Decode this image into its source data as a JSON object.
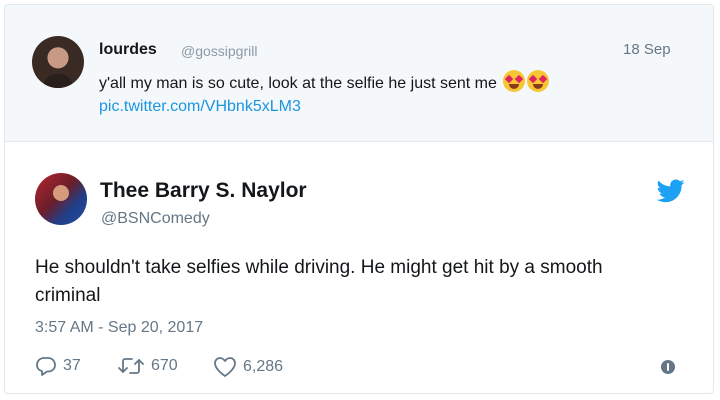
{
  "quoted": {
    "name": "lourdes",
    "handle": "@gossipgrill",
    "date": "18 Sep",
    "text": "y'all my man is so cute, look at the selfie he just sent me",
    "emoji": "heart-eyes-emoji x2",
    "link": "pic.twitter.com/VHbnk5xLM3"
  },
  "tweet": {
    "name": "Thee Barry S. Naylor",
    "handle": "@BSNComedy",
    "body": "He shouldn't take selfies while driving. He might get hit by a smooth criminal",
    "time": "3:57 AM - Sep 20, 2017",
    "replies": "37",
    "retweets": "670",
    "likes": "6,286"
  },
  "colors": {
    "link": "#1b95e0",
    "muted": "#657786",
    "quoted_bg": "#f5f8fa",
    "twitter_blue": "#1da1f2"
  },
  "icons": [
    "twitter-bird-icon",
    "reply-icon",
    "retweet-icon",
    "like-icon",
    "info-icon"
  ]
}
